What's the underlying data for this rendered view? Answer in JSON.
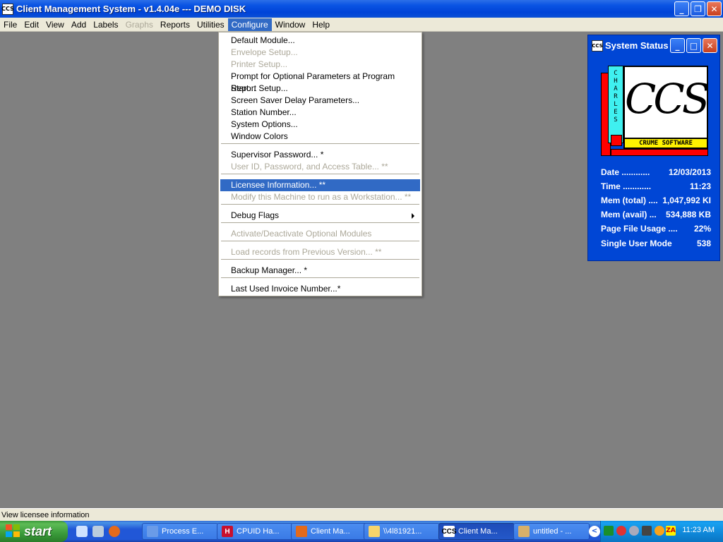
{
  "window": {
    "title": "Client Management System - v1.4.04e --- DEMO DISK",
    "icon_text": "CCS"
  },
  "menubar": [
    {
      "label": "File",
      "disabled": false
    },
    {
      "label": "Edit",
      "disabled": false
    },
    {
      "label": "View",
      "disabled": false
    },
    {
      "label": "Add",
      "disabled": false
    },
    {
      "label": "Labels",
      "disabled": false
    },
    {
      "label": "Graphs",
      "disabled": true
    },
    {
      "label": "Reports",
      "disabled": false
    },
    {
      "label": "Utilities",
      "disabled": false
    },
    {
      "label": "Configure",
      "disabled": false,
      "active": true
    },
    {
      "label": "Window",
      "disabled": false
    },
    {
      "label": "Help",
      "disabled": false
    }
  ],
  "configure_menu": {
    "items": [
      {
        "label": "Default Module...",
        "disabled": false
      },
      {
        "label": "Envelope Setup...",
        "disabled": true
      },
      {
        "label": "Printer Setup...",
        "disabled": true
      },
      {
        "label": "Prompt for Optional Parameters at Program Start...",
        "disabled": false
      },
      {
        "label": "Report Setup...",
        "disabled": false
      },
      {
        "label": "Screen Saver Delay Parameters...",
        "disabled": false
      },
      {
        "label": "Station Number...",
        "disabled": false
      },
      {
        "label": "System Options...",
        "disabled": false
      },
      {
        "label": "Window Colors",
        "disabled": false
      },
      {
        "label": "Supervisor Password... *",
        "disabled": false
      },
      {
        "label": "User ID, Password, and Access Table... **",
        "disabled": true
      },
      {
        "label": "Licensee Information... **",
        "disabled": false,
        "selected": true
      },
      {
        "label": "Modify this Machine to run as a Workstation... **",
        "disabled": true
      },
      {
        "label": "Debug Flags",
        "disabled": false,
        "submenu": true
      },
      {
        "label": "Activate/Deactivate Optional Modules",
        "disabled": true
      },
      {
        "label": "Load records from Previous Version... **",
        "disabled": true
      },
      {
        "label": "Backup Manager... *",
        "disabled": false
      },
      {
        "label": "Last Used Invoice Number...*",
        "disabled": false
      }
    ]
  },
  "system_status": {
    "title": "System Status",
    "logo": {
      "side_text": "CHARLES",
      "main_text": "CCS",
      "bottom_text": "CRUME SOFTWARE"
    },
    "rows": [
      {
        "label": "Date ............",
        "value": "12/03/2013"
      },
      {
        "label": "Time ............",
        "value": "11:23"
      },
      {
        "label": "Mem (total) ....",
        "value": "1,047,992 KI"
      },
      {
        "label": "Mem (avail) ...",
        "value": "534,888 KB"
      },
      {
        "label": "Page File Usage ....",
        "value": "22%"
      },
      {
        "label": "Single User Mode",
        "value": "538"
      }
    ]
  },
  "statusbar": {
    "text": "View licensee information"
  },
  "taskbar": {
    "start_label": "start",
    "tasks": [
      {
        "label": "Process E...",
        "icon": "process-explorer-icon",
        "icon_text": ""
      },
      {
        "label": "CPUID Ha...",
        "icon": "cpuid-icon",
        "icon_text": "H"
      },
      {
        "label": "Client Ma...",
        "icon": "firefox-icon",
        "icon_text": ""
      },
      {
        "label": "\\\\4l81921...",
        "icon": "folder-icon",
        "icon_text": ""
      },
      {
        "label": "Client Ma...",
        "icon": "ccs-app-icon",
        "icon_text": "CCS",
        "active": true
      },
      {
        "label": "untitled - ...",
        "icon": "paint-icon",
        "icon_text": ""
      }
    ],
    "clock": "11:23 AM",
    "tray_toggle": "<"
  },
  "colors": {
    "accent": "#316ac5",
    "desktop": "#808080",
    "status_window": "#0046d5"
  }
}
